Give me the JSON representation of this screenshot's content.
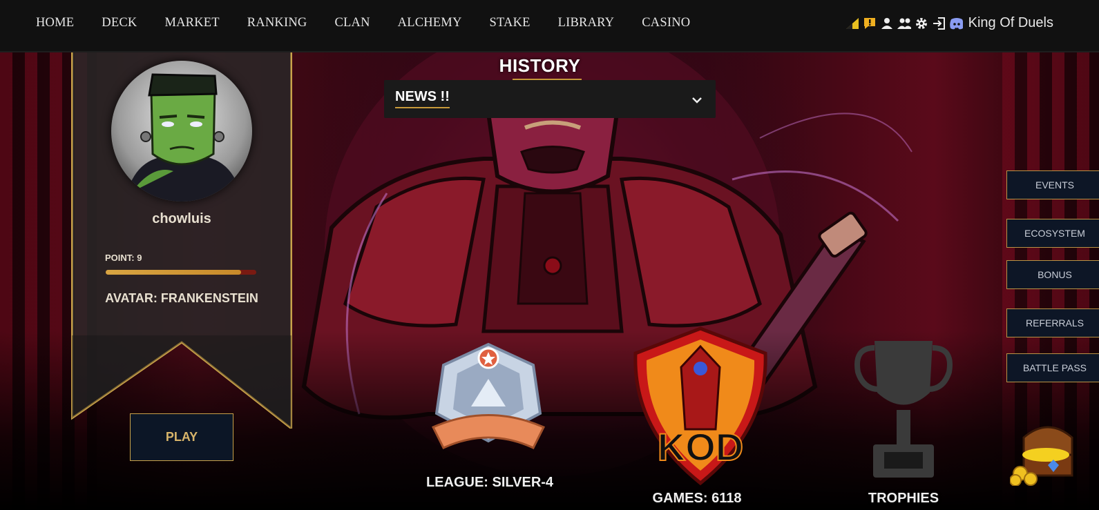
{
  "nav": {
    "items": [
      {
        "label": "HOME"
      },
      {
        "label": "DECK"
      },
      {
        "label": "MARKET"
      },
      {
        "label": "RANKING"
      },
      {
        "label": "CLAN"
      },
      {
        "label": "ALCHEMY"
      },
      {
        "label": "STAKE"
      },
      {
        "label": "LIBRARY"
      },
      {
        "label": "CASINO"
      }
    ],
    "tool_icons": [
      "signal-icon",
      "alert-icon",
      "user-icon",
      "users-icon",
      "gear-icon",
      "logout-icon",
      "discord-icon"
    ],
    "brand": "King Of Duels"
  },
  "history": {
    "title": "HISTORY",
    "news_label": "NEWS !!"
  },
  "profile": {
    "username": "chowluis",
    "points_label": "POINT: 9",
    "points_progress_percent": 90,
    "avatar_label": "AVATAR: FRANKENSTEIN",
    "play_label": "PLAY"
  },
  "side_menu": [
    {
      "label": "EVENTS"
    },
    {
      "label": "ECOSYSTEM"
    },
    {
      "label": "BONUS"
    },
    {
      "label": "REFERRALS"
    },
    {
      "label": "BATTLE PASS"
    }
  ],
  "stats": {
    "league": "LEAGUE: SILVER-4",
    "games": "GAMES: 6118",
    "trophies": "TROPHIES",
    "kod_logo_text": "KOD"
  },
  "colors": {
    "accent_gold": "#c89a3a",
    "button_bg": "#0c1626",
    "topbar_bg": "#111111",
    "progress_track": "#7a1a12"
  }
}
